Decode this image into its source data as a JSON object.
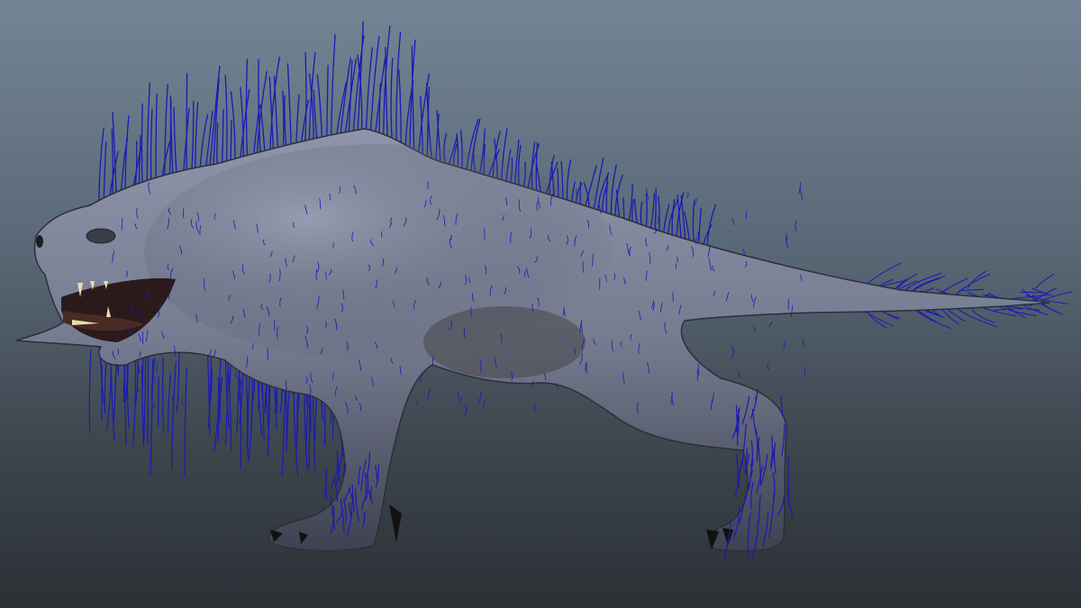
{
  "scene": {
    "subject": "creature-model-with-hair-guides",
    "colors": {
      "background_top": "#738494",
      "background_bottom": "#2b3035",
      "skin_light": "#8c93a8",
      "skin_dark": "#3e4250",
      "hair_guides": "#1a1ab4",
      "mouth": "#2a1a1a",
      "teeth": "#e8dcb0"
    }
  }
}
